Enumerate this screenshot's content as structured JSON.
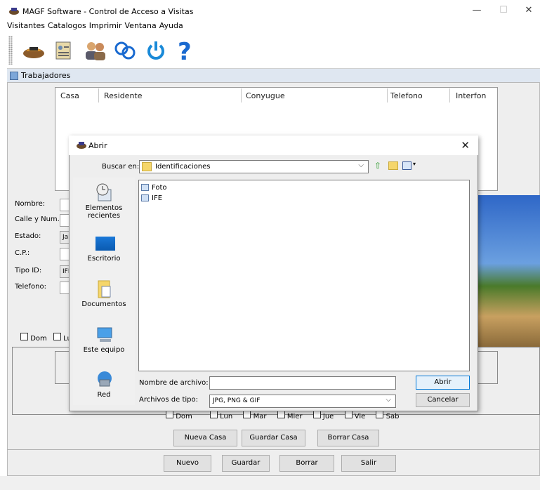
{
  "window": {
    "title": "MAGF Software - Control de Acceso a Visitas"
  },
  "menubar": {
    "items": [
      "Visitantes",
      "Catalogos",
      "Imprimir",
      "Ventana",
      "Ayuda"
    ]
  },
  "internal_frame": {
    "title": "Trabajadores"
  },
  "table": {
    "columns": [
      "Casa",
      "Residente",
      "Conyugue",
      "Telefono",
      "Interfon"
    ]
  },
  "form": {
    "labels": {
      "nombre": "Nombre:",
      "calle": "Calle y Num.:",
      "estado": "Estado:",
      "cp": "C.P.:",
      "tipo_id": "Tipo ID:",
      "telefono": "Telefono:"
    },
    "estado_value": "Jal",
    "tipo_id_value": "IFE"
  },
  "days_upper": [
    "Dom",
    "Lu"
  ],
  "days_lower": [
    "Dom",
    "Lun",
    "Mar",
    "Mier",
    "Jue",
    "Vie",
    "Sab"
  ],
  "buttons": {
    "nueva_casa": "Nueva Casa",
    "guardar_casa": "Guardar Casa",
    "borrar_casa": "Borrar Casa",
    "nuevo": "Nuevo",
    "guardar": "Guardar",
    "borrar": "Borrar",
    "salir": "Salir"
  },
  "dialog": {
    "title": "Abrir",
    "look_in_label": "Buscar en:",
    "look_in_value": "Identificaciones",
    "places": [
      "Elementos recientes",
      "Escritorio",
      "Documentos",
      "Este equipo",
      "Red"
    ],
    "files": [
      "Foto",
      "IFE"
    ],
    "filename_label": "Nombre de archivo:",
    "filename_value": "",
    "filetype_label": "Archivos de tipo:",
    "filetype_value": "JPG, PNG & GIF",
    "open_button": "Abrir",
    "cancel_button": "Cancelar"
  },
  "colors": {
    "accent_blue": "#0078d7",
    "frame_title_bg": "#dfe7f1"
  },
  "icons": [
    "car-icon",
    "id-card-icon",
    "people-icon",
    "search-icon",
    "power-icon",
    "help-icon"
  ]
}
